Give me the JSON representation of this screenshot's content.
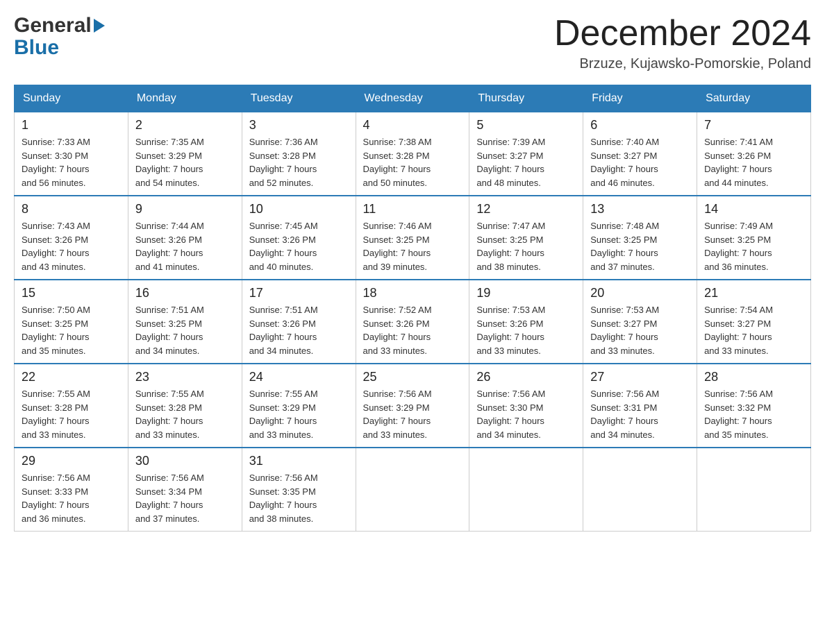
{
  "header": {
    "logo_general": "General",
    "logo_blue": "Blue",
    "month_title": "December 2024",
    "location": "Brzuze, Kujawsko-Pomorskie, Poland"
  },
  "weekdays": [
    "Sunday",
    "Monday",
    "Tuesday",
    "Wednesday",
    "Thursday",
    "Friday",
    "Saturday"
  ],
  "weeks": [
    [
      {
        "day": "1",
        "sunrise": "7:33 AM",
        "sunset": "3:30 PM",
        "daylight": "7 hours and 56 minutes."
      },
      {
        "day": "2",
        "sunrise": "7:35 AM",
        "sunset": "3:29 PM",
        "daylight": "7 hours and 54 minutes."
      },
      {
        "day": "3",
        "sunrise": "7:36 AM",
        "sunset": "3:28 PM",
        "daylight": "7 hours and 52 minutes."
      },
      {
        "day": "4",
        "sunrise": "7:38 AM",
        "sunset": "3:28 PM",
        "daylight": "7 hours and 50 minutes."
      },
      {
        "day": "5",
        "sunrise": "7:39 AM",
        "sunset": "3:27 PM",
        "daylight": "7 hours and 48 minutes."
      },
      {
        "day": "6",
        "sunrise": "7:40 AM",
        "sunset": "3:27 PM",
        "daylight": "7 hours and 46 minutes."
      },
      {
        "day": "7",
        "sunrise": "7:41 AM",
        "sunset": "3:26 PM",
        "daylight": "7 hours and 44 minutes."
      }
    ],
    [
      {
        "day": "8",
        "sunrise": "7:43 AM",
        "sunset": "3:26 PM",
        "daylight": "7 hours and 43 minutes."
      },
      {
        "day": "9",
        "sunrise": "7:44 AM",
        "sunset": "3:26 PM",
        "daylight": "7 hours and 41 minutes."
      },
      {
        "day": "10",
        "sunrise": "7:45 AM",
        "sunset": "3:26 PM",
        "daylight": "7 hours and 40 minutes."
      },
      {
        "day": "11",
        "sunrise": "7:46 AM",
        "sunset": "3:25 PM",
        "daylight": "7 hours and 39 minutes."
      },
      {
        "day": "12",
        "sunrise": "7:47 AM",
        "sunset": "3:25 PM",
        "daylight": "7 hours and 38 minutes."
      },
      {
        "day": "13",
        "sunrise": "7:48 AM",
        "sunset": "3:25 PM",
        "daylight": "7 hours and 37 minutes."
      },
      {
        "day": "14",
        "sunrise": "7:49 AM",
        "sunset": "3:25 PM",
        "daylight": "7 hours and 36 minutes."
      }
    ],
    [
      {
        "day": "15",
        "sunrise": "7:50 AM",
        "sunset": "3:25 PM",
        "daylight": "7 hours and 35 minutes."
      },
      {
        "day": "16",
        "sunrise": "7:51 AM",
        "sunset": "3:25 PM",
        "daylight": "7 hours and 34 minutes."
      },
      {
        "day": "17",
        "sunrise": "7:51 AM",
        "sunset": "3:26 PM",
        "daylight": "7 hours and 34 minutes."
      },
      {
        "day": "18",
        "sunrise": "7:52 AM",
        "sunset": "3:26 PM",
        "daylight": "7 hours and 33 minutes."
      },
      {
        "day": "19",
        "sunrise": "7:53 AM",
        "sunset": "3:26 PM",
        "daylight": "7 hours and 33 minutes."
      },
      {
        "day": "20",
        "sunrise": "7:53 AM",
        "sunset": "3:27 PM",
        "daylight": "7 hours and 33 minutes."
      },
      {
        "day": "21",
        "sunrise": "7:54 AM",
        "sunset": "3:27 PM",
        "daylight": "7 hours and 33 minutes."
      }
    ],
    [
      {
        "day": "22",
        "sunrise": "7:55 AM",
        "sunset": "3:28 PM",
        "daylight": "7 hours and 33 minutes."
      },
      {
        "day": "23",
        "sunrise": "7:55 AM",
        "sunset": "3:28 PM",
        "daylight": "7 hours and 33 minutes."
      },
      {
        "day": "24",
        "sunrise": "7:55 AM",
        "sunset": "3:29 PM",
        "daylight": "7 hours and 33 minutes."
      },
      {
        "day": "25",
        "sunrise": "7:56 AM",
        "sunset": "3:29 PM",
        "daylight": "7 hours and 33 minutes."
      },
      {
        "day": "26",
        "sunrise": "7:56 AM",
        "sunset": "3:30 PM",
        "daylight": "7 hours and 34 minutes."
      },
      {
        "day": "27",
        "sunrise": "7:56 AM",
        "sunset": "3:31 PM",
        "daylight": "7 hours and 34 minutes."
      },
      {
        "day": "28",
        "sunrise": "7:56 AM",
        "sunset": "3:32 PM",
        "daylight": "7 hours and 35 minutes."
      }
    ],
    [
      {
        "day": "29",
        "sunrise": "7:56 AM",
        "sunset": "3:33 PM",
        "daylight": "7 hours and 36 minutes."
      },
      {
        "day": "30",
        "sunrise": "7:56 AM",
        "sunset": "3:34 PM",
        "daylight": "7 hours and 37 minutes."
      },
      {
        "day": "31",
        "sunrise": "7:56 AM",
        "sunset": "3:35 PM",
        "daylight": "7 hours and 38 minutes."
      },
      null,
      null,
      null,
      null
    ]
  ],
  "labels": {
    "sunrise_prefix": "Sunrise: ",
    "sunset_prefix": "Sunset: ",
    "daylight_prefix": "Daylight: "
  }
}
